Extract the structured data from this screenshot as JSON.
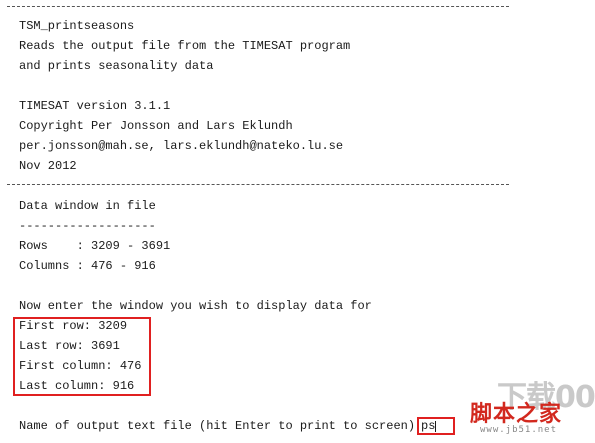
{
  "header": {
    "program_name": "TSM_printseasons",
    "description_1": "Reads the output file from the TIMESAT program",
    "description_2": "and prints seasonality data",
    "version": "TIMESAT version 3.1.1",
    "copyright": "Copyright Per Jonsson and Lars Eklundh",
    "emails": "per.jonsson@mah.se, lars.eklundh@nateko.lu.se",
    "date": "Nov 2012"
  },
  "data_window": {
    "title": "Data window in file",
    "underline": "-------------------",
    "rows": "Rows    : 3209 - 3691",
    "columns": "Columns : 476 - 916"
  },
  "prompt": {
    "intro": "Now enter the window you wish to display data for",
    "first_row": "First row: 3209",
    "last_row": "Last row: 3691",
    "first_column": "First column: 476",
    "last_column": "Last column: 916",
    "output_file_label": "Name of output text file (hit Enter to print to screen):",
    "output_file_value": "ps"
  },
  "watermark": {
    "logo_text": "下载000",
    "cn_text": "脚本之家",
    "url": "www.jb51.net"
  },
  "colors": {
    "highlight_border": "#e02020",
    "watermark_red": "#d2281e",
    "text": "#1a1a1a",
    "background": "#ffffff"
  }
}
